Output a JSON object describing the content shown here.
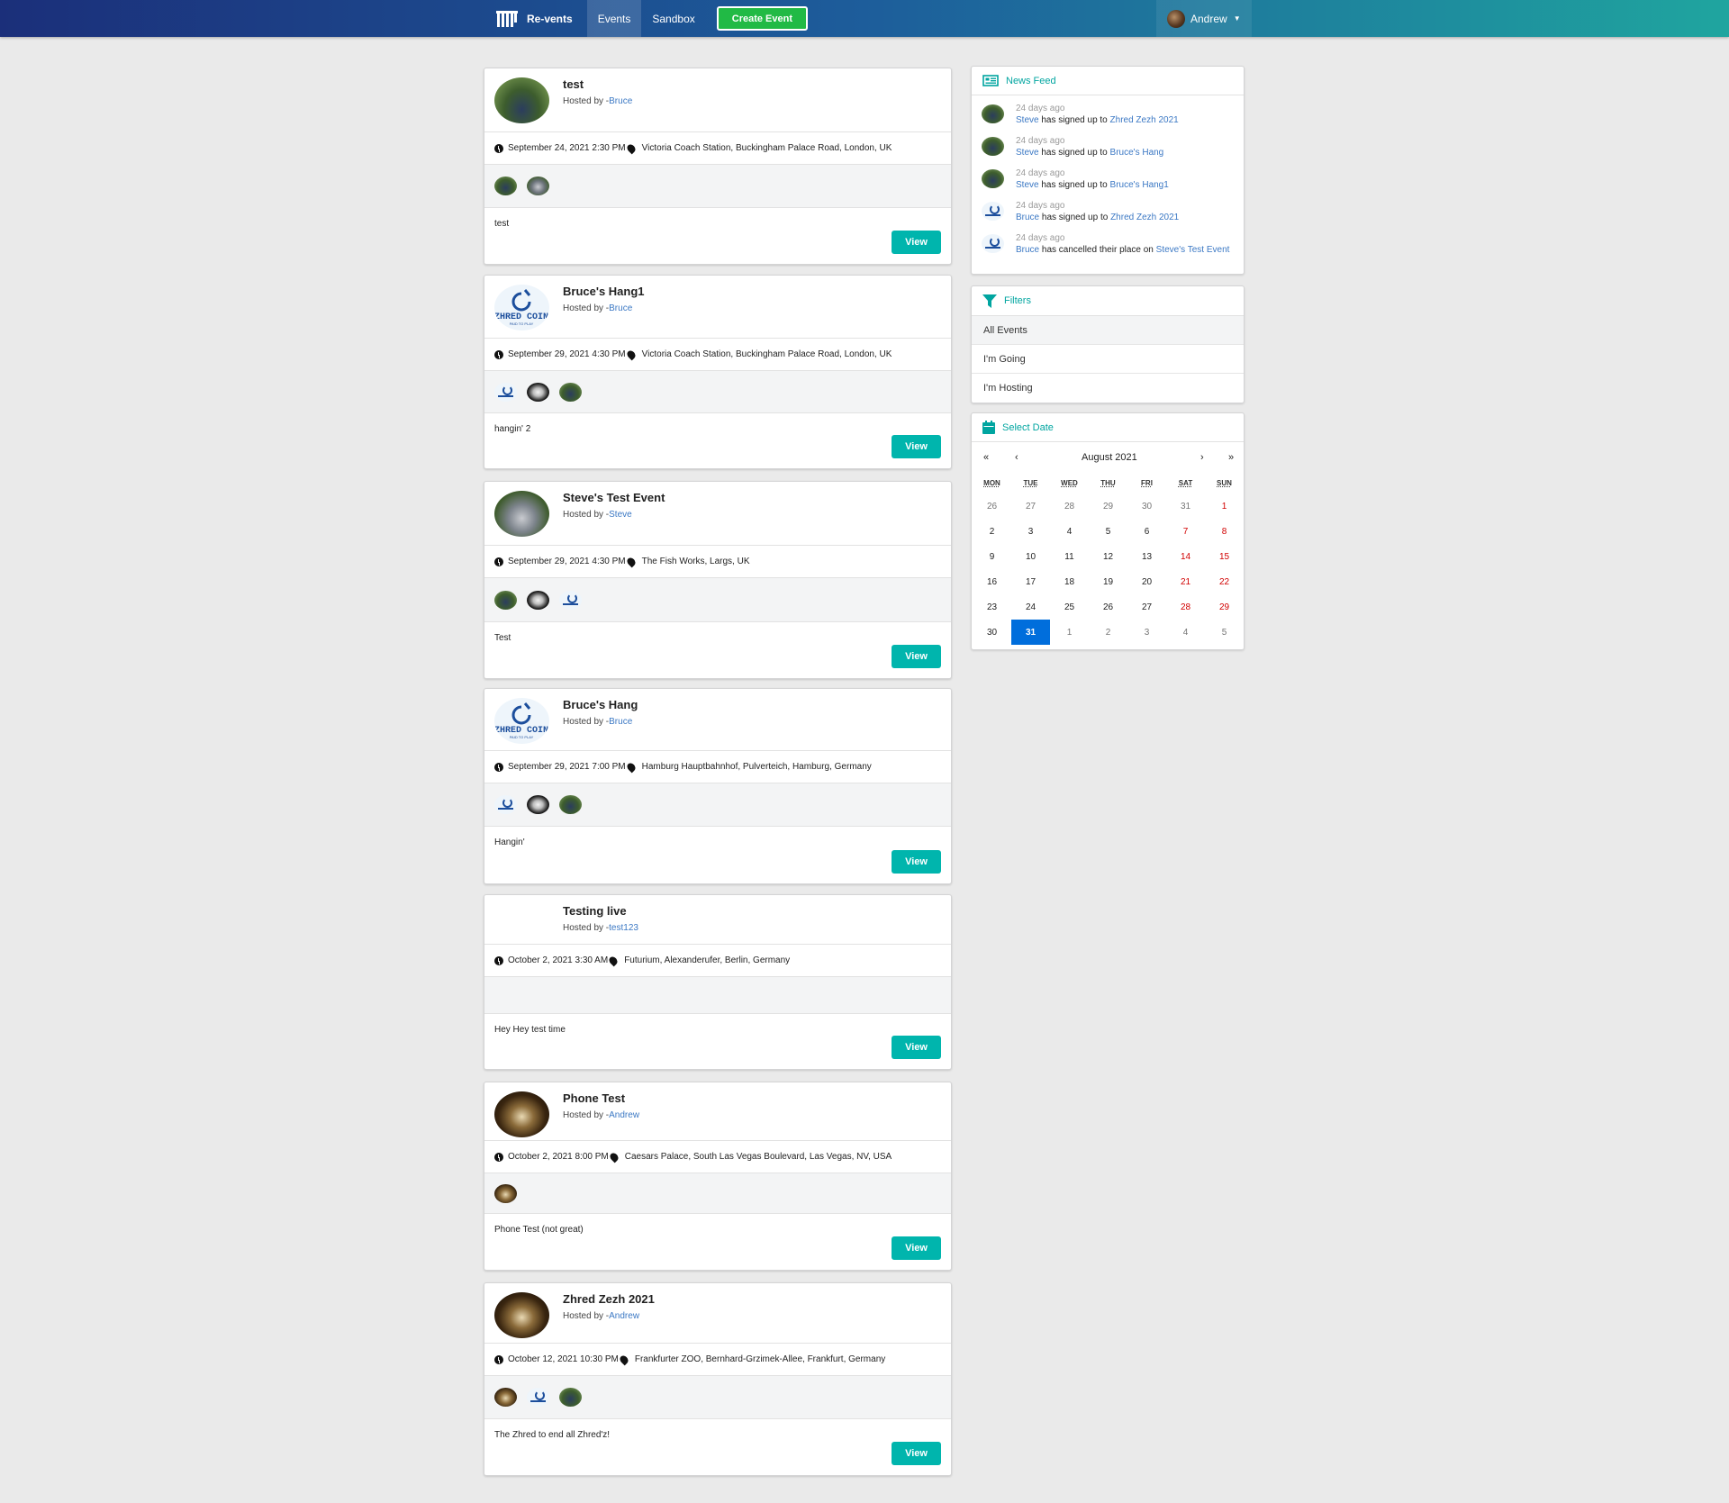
{
  "nav": {
    "brand": "Re-vents",
    "items": [
      "Events",
      "Sandbox"
    ],
    "create_label": "Create Event",
    "user_name": "Andrew"
  },
  "events": [
    {
      "title": "test",
      "host_prefix": "Hosted by -",
      "host": "Bruce",
      "date": "September 24, 2021 2:30 PM",
      "venue": "Victoria Coach Station, Buckingham Palace Road, London, UK",
      "description": "test",
      "view_label": "View",
      "thumb": "car-photo",
      "attendees": [
        "car-photo",
        "car-photo"
      ]
    },
    {
      "title": "Bruce's Hang1",
      "host_prefix": "Hosted by -",
      "host": "Bruce",
      "date": "September 29, 2021 4:30 PM",
      "venue": "Victoria Coach Station, Buckingham Palace Road, London, UK",
      "description": "hangin' 2",
      "view_label": "View",
      "thumb": "zhred-coin-logo",
      "attendees": [
        "zhred-coin-logo",
        "shoe-photo",
        "car-photo"
      ]
    },
    {
      "title": "Steve's Test Event",
      "host_prefix": "Hosted by -",
      "host": "Steve",
      "date": "September 29, 2021 4:30 PM",
      "venue": "The Fish Works, Largs, UK",
      "description": "Test",
      "view_label": "View",
      "thumb": "car-photo",
      "attendees": [
        "car-photo",
        "shoe-photo",
        "zhred-coin-logo"
      ]
    },
    {
      "title": "Bruce's Hang",
      "host_prefix": "Hosted by -",
      "host": "Bruce",
      "date": "September 29, 2021 7:00 PM",
      "venue": "Hamburg Hauptbahnhof, Pulverteich, Hamburg, Germany",
      "description": "Hangin'",
      "view_label": "View",
      "thumb": "zhred-coin-logo",
      "attendees": [
        "zhred-coin-logo",
        "shoe-photo",
        "car-photo"
      ]
    },
    {
      "title": "Testing live",
      "host_prefix": "Hosted by -",
      "host": "test123",
      "date": "October 2, 2021 3:30 AM",
      "venue": "Futurium, Alexanderufer, Berlin, Germany",
      "description": "Hey Hey test time",
      "view_label": "View",
      "thumb": "none",
      "attendees": []
    },
    {
      "title": "Phone Test",
      "host_prefix": "Hosted by -",
      "host": "Andrew",
      "date": "October 2, 2021 8:00 PM",
      "venue": "Caesars Palace, South Las Vegas Boulevard, Las Vegas, NV, USA",
      "description": "Phone Test (not great)",
      "view_label": "View",
      "thumb": "food-photo",
      "attendees": [
        "food-photo"
      ]
    },
    {
      "title": "Zhred Zezh 2021",
      "host_prefix": "Hosted by -",
      "host": "Andrew",
      "date": "October 12, 2021 10:30 PM",
      "venue": "Frankfurter ZOO, Bernhard-Grzimek-Allee, Frankfurt, Germany",
      "description": "The Zhred to end all Zhred'z!",
      "view_label": "View",
      "thumb": "food-photo",
      "attendees": [
        "food-photo",
        "zhred-coin-logo",
        "car-photo"
      ]
    }
  ],
  "news_feed": {
    "title": "News Feed",
    "items": [
      {
        "ago": "24 days ago",
        "user": "Steve",
        "action": " has signed up to ",
        "event": "Zhred Zezh 2021",
        "avatar": "car-photo"
      },
      {
        "ago": "24 days ago",
        "user": "Steve",
        "action": " has signed up to ",
        "event": "Bruce's Hang",
        "avatar": "car-photo"
      },
      {
        "ago": "24 days ago",
        "user": "Steve",
        "action": " has signed up to ",
        "event": "Bruce's Hang1",
        "avatar": "car-photo"
      },
      {
        "ago": "24 days ago",
        "user": "Bruce",
        "action": " has signed up to ",
        "event": "Zhred Zezh 2021",
        "avatar": "zhred-coin-logo"
      },
      {
        "ago": "24 days ago",
        "user": "Bruce",
        "action": " has cancelled their place on ",
        "event": "Steve's Test Event",
        "avatar": "zhred-coin-logo"
      }
    ]
  },
  "filters": {
    "title": "Filters",
    "items": [
      "All Events",
      "I'm Going",
      "I'm Hosting"
    ],
    "active": "All Events"
  },
  "calendar": {
    "title": "Select Date",
    "month": "August 2021",
    "nav": {
      "prev_year": "«",
      "prev": "‹",
      "next": "›",
      "next_year": "»"
    },
    "weekdays": [
      "MON",
      "TUE",
      "WED",
      "THU",
      "FRI",
      "SAT",
      "SUN"
    ],
    "weeks": [
      [
        "26",
        "27",
        "28",
        "29",
        "30",
        "31",
        "1"
      ],
      [
        "2",
        "3",
        "4",
        "5",
        "6",
        "7",
        "8"
      ],
      [
        "9",
        "10",
        "11",
        "12",
        "13",
        "14",
        "15"
      ],
      [
        "16",
        "17",
        "18",
        "19",
        "20",
        "21",
        "22"
      ],
      [
        "23",
        "24",
        "25",
        "26",
        "27",
        "28",
        "29"
      ],
      [
        "30",
        "31",
        "1",
        "2",
        "3",
        "4",
        "5"
      ]
    ],
    "selected": "31"
  },
  "colors": {
    "accent": "#00b5ad",
    "link": "#3b78c4",
    "create": "#21ba45",
    "selected_day": "#006edc",
    "weekend": "#d10000"
  }
}
